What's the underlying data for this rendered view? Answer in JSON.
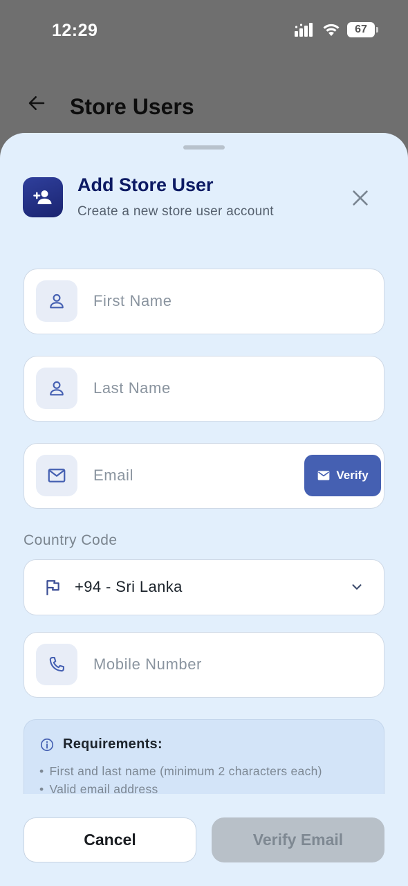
{
  "status_bar": {
    "time": "12:29",
    "battery": "67"
  },
  "header": {
    "title": "Store Users"
  },
  "modal": {
    "title": "Add Store User",
    "subtitle": "Create a new store user account",
    "icon": "person-add-icon"
  },
  "form": {
    "first_name": {
      "placeholder": "First Name",
      "icon": "person-icon"
    },
    "last_name": {
      "placeholder": "Last Name",
      "icon": "person-icon"
    },
    "email": {
      "placeholder": "Email",
      "icon": "mail-icon",
      "verify_label": "Verify"
    },
    "country_code": {
      "label": "Country Code",
      "value": "+94 - Sri Lanka",
      "icon": "flag-icon"
    },
    "mobile": {
      "placeholder": "Mobile Number",
      "icon": "phone-icon"
    }
  },
  "requirements": {
    "title": "Requirements:",
    "items": [
      "First and last name (minimum 2 characters each)",
      "Valid email address"
    ]
  },
  "actions": {
    "cancel": "Cancel",
    "verify_email": "Verify Email"
  },
  "colors": {
    "accent": "#4560b2",
    "title": "#0c1a63",
    "sheet_bg": "#e2effc",
    "disabled_button": "#b8c0c8"
  }
}
